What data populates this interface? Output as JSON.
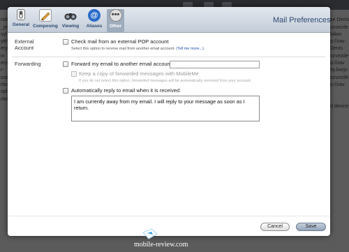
{
  "background": {
    "left_rows": [
      "",
      "nde",
      "_pr",
      "syl",
      "ykh",
      "ery",
      "in",
      "ery",
      "r-",
      "ssa",
      "rbs",
      "opl",
      "rbe",
      "",
      "",
      "",
      "",
      "",
      "",
      "",
      "",
      "",
      "",
      "",
      "",
      "",
      "",
      "",
      "",
      "",
      "",
      "",
      ""
    ],
    "right_rows": [
      "",
      "se Denis",
      "ozvezde",
      "lalian",
      "p://zav",
      "Denis",
      "ozvezde",
      "p://zav",
      "tty.livejo",
      "ozvezde",
      "p://zav",
      "",
      "",
      "d device",
      "",
      "",
      "",
      "",
      "",
      "",
      "",
      "",
      "",
      "",
      "",
      "",
      "",
      "",
      "",
      "",
      "",
      "",
      ""
    ]
  },
  "toolbar": {
    "title": "Mail Preferences",
    "items": [
      {
        "label": "General",
        "icon": "general-switch-icon",
        "active": false
      },
      {
        "label": "Composing",
        "icon": "pencil-icon",
        "active": false
      },
      {
        "label": "Viewing",
        "icon": "binoculars-icon",
        "active": false
      },
      {
        "label": "Aliases",
        "icon": "at-sign-icon",
        "active": false
      },
      {
        "label": "Other",
        "icon": "ellipsis-icon",
        "active": true
      }
    ]
  },
  "external_account": {
    "section_label_1": "External",
    "section_label_2": "Account",
    "checkbox_label": "Check mail from an external POP account",
    "hint": "Select this option to receive mail from another email account.",
    "link": "(Tell me more...)"
  },
  "forwarding": {
    "section_label": "Forwarding",
    "forward_label": "Forward my email to another email account:",
    "forward_value": "",
    "keep_copy_label": "Keep a copy of forwarded messages with MobileMe",
    "keep_copy_hint": "If you do not select this option, forwarded messages will be automatically removed from your account.",
    "auto_reply_label": "Automatically reply to email when it is received:",
    "auto_reply_text": "I am currently away from my email. I will reply to your message as soon as I return."
  },
  "buttons": {
    "cancel": "Cancel",
    "save": "Save"
  },
  "watermark": {
    "text": "mobile-review.com"
  },
  "colors": {
    "accent": "#2d4a70",
    "link": "#1d4fa8",
    "active_tab": "#9eacbd"
  }
}
